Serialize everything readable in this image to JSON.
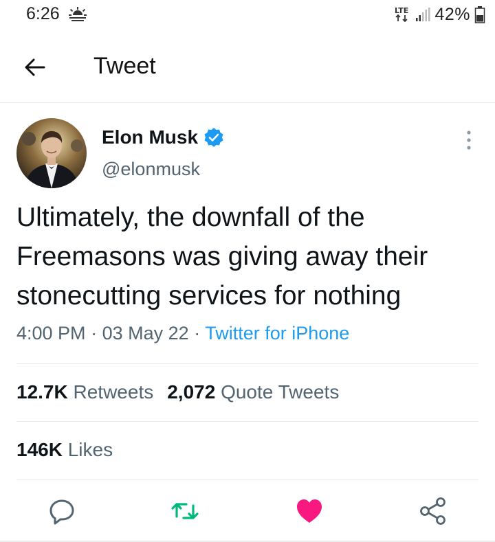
{
  "status_bar": {
    "time": "6:26",
    "weather_icon": "sun-haze-icon",
    "network": "LTE",
    "battery": "42%"
  },
  "header": {
    "title": "Tweet",
    "back_icon": "arrow-left-icon"
  },
  "tweet": {
    "author_name": "Elon Musk",
    "author_handle": "@elonmusk",
    "verified": true,
    "text": "Ultimately, the downfall of the Freemasons was giving away their stonecutting services for nothing",
    "time": "4:00 PM",
    "date": "03 May 22",
    "separator": "·",
    "source": "Twitter for iPhone"
  },
  "stats": {
    "retweets_count": "12.7K",
    "retweets_label": "Retweets",
    "quotes_count": "2,072",
    "quotes_label": "Quote Tweets",
    "likes_count": "146K",
    "likes_label": "Likes"
  },
  "actions": {
    "reply_icon": "reply-icon",
    "retweet_icon": "retweet-icon",
    "like_icon": "heart-icon",
    "share_icon": "share-icon"
  },
  "colors": {
    "accent": "#1d9bf0",
    "retweet": "#00ba7c",
    "like": "#f91880",
    "secondary_text": "#536471"
  }
}
